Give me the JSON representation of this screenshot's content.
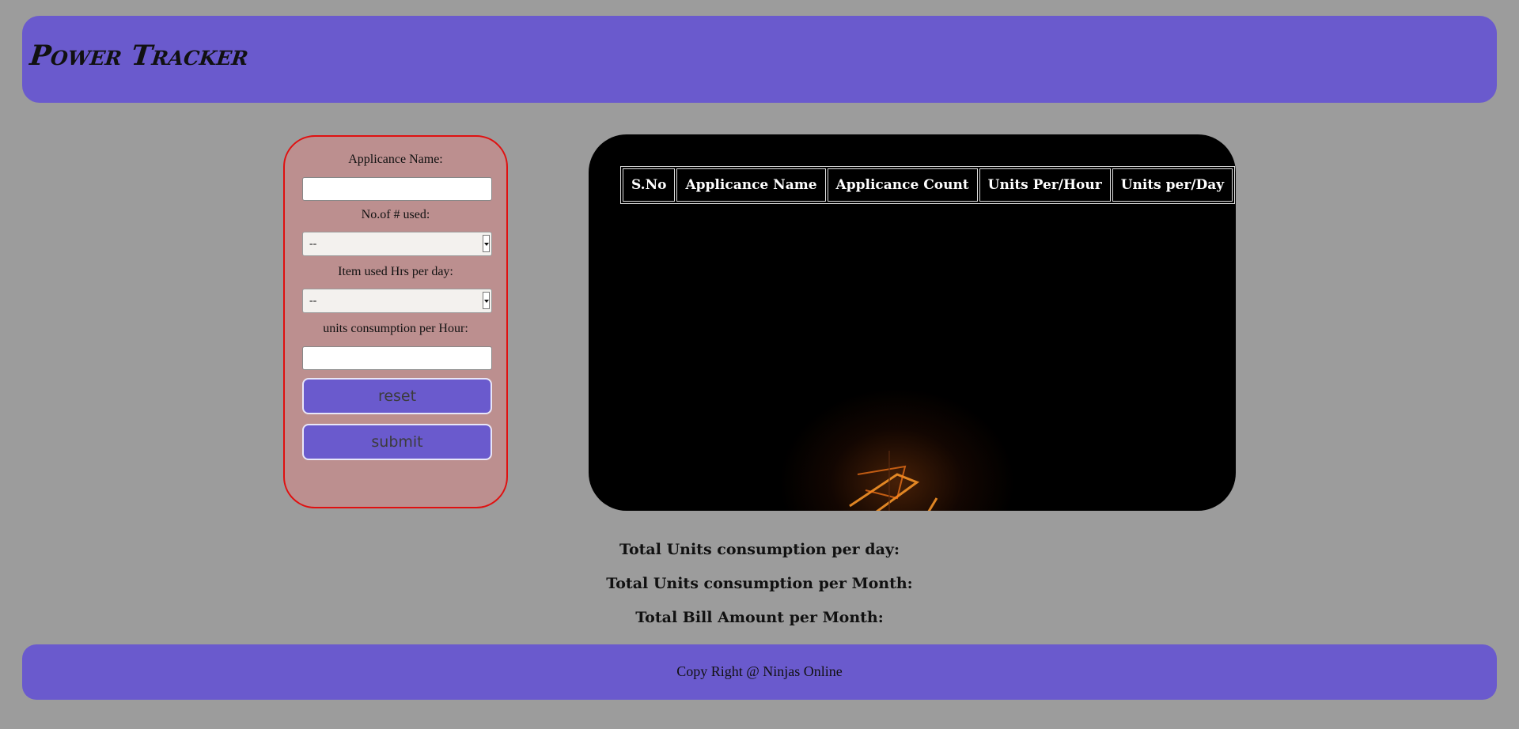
{
  "header": {
    "title": "Power Tracker"
  },
  "form": {
    "appliance_name_label": "Applicance Name:",
    "appliance_name_value": "",
    "count_label": "No.of # used:",
    "count_selected": "--",
    "hours_label": "Item used Hrs per day:",
    "hours_selected": "--",
    "units_label": "units consumption per Hour:",
    "units_value": "",
    "reset_label": "reset",
    "submit_label": "submit"
  },
  "table": {
    "columns": [
      "S.No",
      "Applicance Name",
      "Applicance Count",
      "Units Per/Hour",
      "Units per/Day"
    ],
    "rows": []
  },
  "totals": {
    "per_day_label": "Total Units consumption per day:",
    "per_month_label": "Total Units consumption per Month:",
    "bill_label": "Total Bill Amount per Month:"
  },
  "footer": {
    "text": "Copy Right @ Ninjas Online"
  },
  "colors": {
    "accent": "#6a5acd",
    "page_background": "#9c9c9c",
    "form_background": "#bc8f8f",
    "form_border": "#e01010",
    "table_background": "#000000"
  },
  "background_image": "glowing-filament-bulb"
}
